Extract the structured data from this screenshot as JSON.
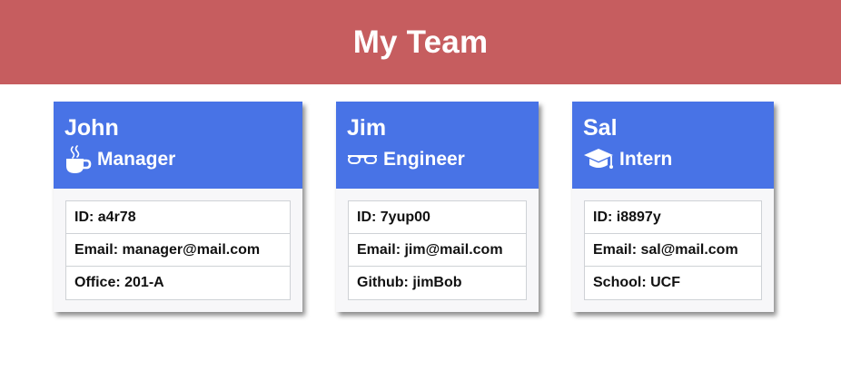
{
  "page": {
    "title": "My Team",
    "header_color": "#c65d5f"
  },
  "colors": {
    "card_header": "#4873e6",
    "card_body": "#f7f7f9"
  },
  "cards": [
    {
      "name": "John",
      "role": "Manager",
      "icon": "coffee-mug-icon",
      "details": [
        "ID: a4r78",
        "Email: manager@mail.com",
        "Office: 201-A"
      ]
    },
    {
      "name": "Jim",
      "role": "Engineer",
      "icon": "glasses-icon",
      "details": [
        "ID: 7yup00",
        "Email: jim@mail.com",
        "Github: jimBob"
      ]
    },
    {
      "name": "Sal",
      "role": "Intern",
      "icon": "graduation-cap-icon",
      "details": [
        "ID: i8897y",
        "Email: sal@mail.com",
        "School: UCF"
      ]
    }
  ]
}
